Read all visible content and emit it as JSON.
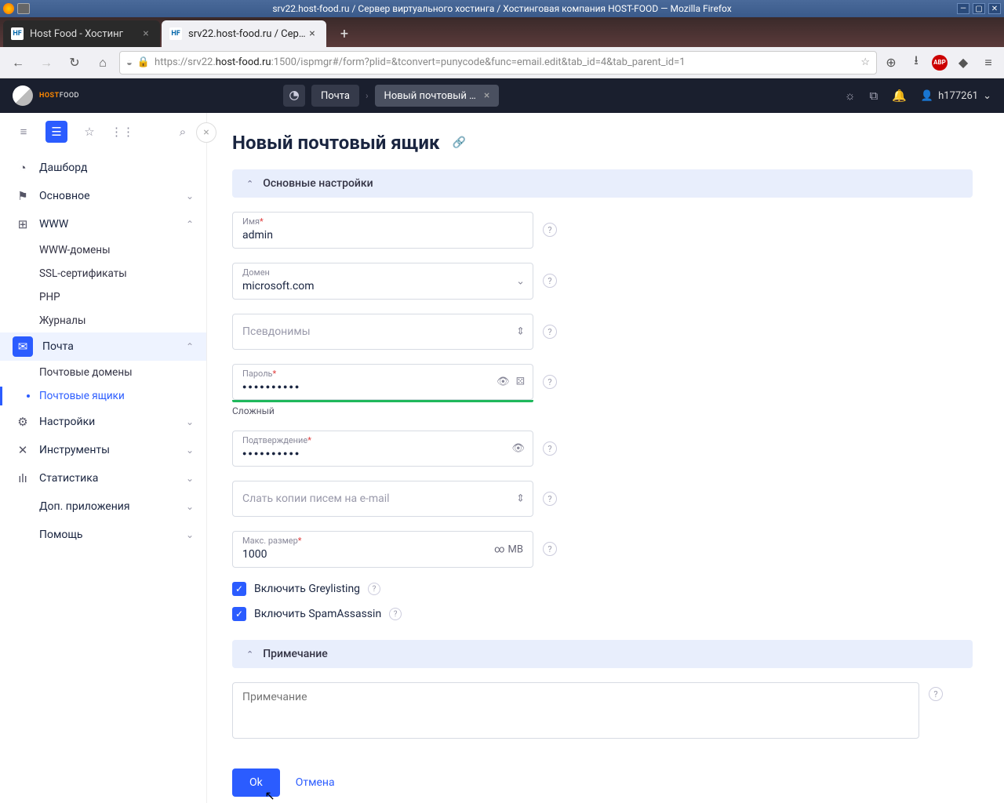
{
  "os": {
    "title": "srv22.host-food.ru / Сервер виртуального хостинга / Хостинговая компания HOST-FOOD — Mozilla Firefox"
  },
  "tabs": [
    {
      "label": "Host Food - Хостинг"
    },
    {
      "label": "srv22.host-food.ru / Сервер…"
    }
  ],
  "url": {
    "prefix": "https://srv22.",
    "bold": "host-food.ru",
    "suffix": ":1500/ispmgr#/form?plid=&tconvert=punycode&func=email.edit&tab_id=4&tab_parent_id=1"
  },
  "brand": {
    "part1": "HOST",
    "part2": "FOOD"
  },
  "breadcrumb": {
    "mail": "Почта",
    "current": "Новый почтовый …"
  },
  "user": "h177261",
  "sidebar": {
    "dashboard": "Дашборд",
    "main": "Основное",
    "www": "WWW",
    "www_domains": "WWW-домены",
    "ssl": "SSL-сертификаты",
    "php": "PHP",
    "logs": "Журналы",
    "mail": "Почта",
    "mail_domains": "Почтовые домены",
    "mail_boxes": "Почтовые ящики",
    "settings": "Настройки",
    "tools": "Инструменты",
    "stats": "Статистика",
    "addons": "Доп. приложения",
    "help": "Помощь"
  },
  "page": {
    "title": "Новый почтовый ящик",
    "section_main": "Основные настройки",
    "section_note": "Примечание",
    "name_label": "Имя",
    "name_value": "admin",
    "domain_label": "Домен",
    "domain_value": "microsoft.com",
    "aliases_placeholder": "Псевдонимы",
    "password_label": "Пароль",
    "password_value": "●●●●●●●●●●",
    "password_strength": "Сложный",
    "confirm_label": "Подтверждение",
    "confirm_value": "●●●●●●●●●●",
    "forward_placeholder": "Слать копии писем на e-mail",
    "maxsize_label": "Макс. размер",
    "maxsize_value": "1000",
    "maxsize_unit": "MB",
    "greylisting": "Включить Greylisting",
    "spamassassin": "Включить SpamAssassin",
    "note_placeholder": "Примечание",
    "ok": "Ok",
    "cancel": "Отмена"
  }
}
